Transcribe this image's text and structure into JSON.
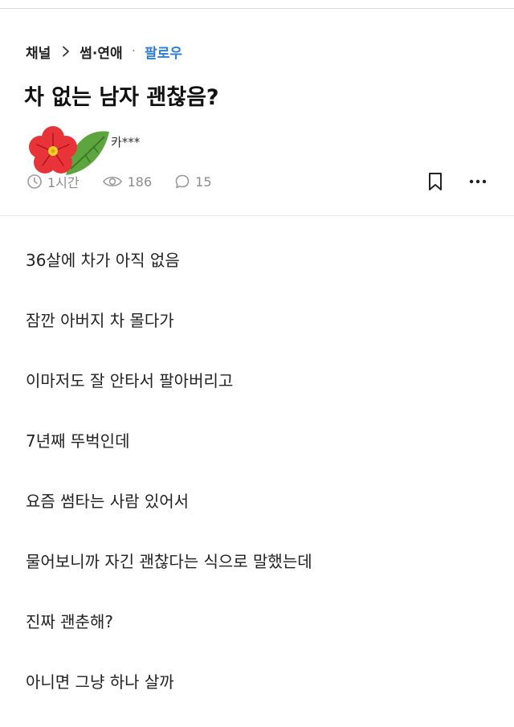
{
  "breadcrumb": {
    "channel": "채널",
    "category": "썸·연애",
    "separator_dot": "·",
    "follow_label": "팔로우",
    "link_color": "#2c7ed6"
  },
  "post": {
    "title": "차 없는 남자 괜찮음?",
    "author": "카***",
    "time": "1시간",
    "views": "186",
    "comments": "15",
    "icons": {
      "time": "clock-icon",
      "views": "eye-icon",
      "comments": "comment-icon",
      "bookmark": "bookmark-icon",
      "more": "more-dots-icon",
      "sticker": "red-flower-sticker"
    },
    "body_lines": [
      "36살에 차가 아직 없음",
      "잠깐 아버지 차 몰다가",
      "이마저도 잘 안타서 팔아버리고",
      "7년째 뚜벅인데",
      "요즘 썸타는 사람 있어서",
      "물어보니까 자긴 괜찮다는 식으로 말했는데",
      "진짜 괜춘해?",
      "아니면 그냥 하나 살까"
    ]
  }
}
